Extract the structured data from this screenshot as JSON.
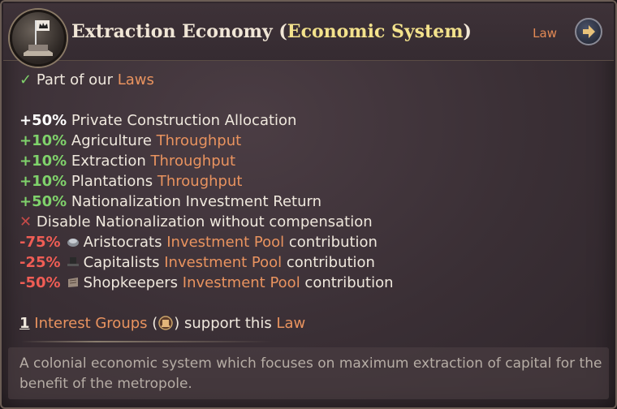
{
  "header": {
    "title": "Extraction Economy",
    "paren_open": " (",
    "subtitle": "Economic System",
    "paren_close": ")",
    "law_link": "Law"
  },
  "part_of": {
    "prefix": "Part of our ",
    "link": "Laws"
  },
  "modifiers": [
    {
      "value": "+50%",
      "label": "Private Construction Allocation"
    },
    {
      "value": "+10%",
      "label": "Agriculture ",
      "link": "Throughput"
    },
    {
      "value": "+10%",
      "label": "Extraction ",
      "link": "Throughput"
    },
    {
      "value": "+10%",
      "label": "Plantations ",
      "link": "Throughput"
    },
    {
      "value": "+50%",
      "label": "Nationalization Investment Return"
    },
    {
      "label": "Disable Nationalization without compensation"
    },
    {
      "value": "-75%",
      "pop": "Aristocrats",
      "link": "Investment Pool",
      "suffix": " contribution"
    },
    {
      "value": "-25%",
      "pop": "Capitalists",
      "link": "Investment Pool",
      "suffix": " contribution"
    },
    {
      "value": "-50%",
      "pop": "Shopkeepers",
      "link": "Investment Pool",
      "suffix": " contribution"
    }
  ],
  "support": {
    "count": "1",
    "link": "Interest Groups",
    "paren_open": " (",
    "paren_close": ") support this ",
    "law_link": "Law"
  },
  "description": "A colonial economic system which focuses on maximum extraction of capital for the benefit of the metropole.",
  "colors": {
    "positive": "#7fd16b",
    "negative": "#ef5d55",
    "link": "#e9935f",
    "title_highlight": "#f3e28c"
  },
  "icons": {
    "law_emblem": "crown-flag-emblem-icon",
    "navigate": "arrow-right-icon",
    "check": "check-icon",
    "disabled": "cross-icon",
    "interest_group": "interest-group-icon"
  }
}
